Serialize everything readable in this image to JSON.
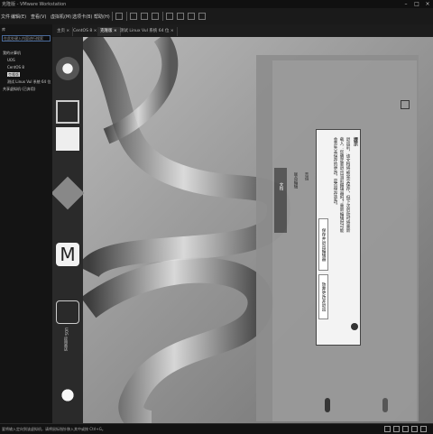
{
  "window": {
    "title": "克隆版 - VMware Workstation"
  },
  "menu": {
    "file": "文件",
    "edit": "编辑(E)",
    "view": "查看(V)",
    "vm": "虚拟机(M)",
    "tabs": "选项卡(B)",
    "help": "帮助(H)"
  },
  "library": {
    "header": "库",
    "search_placeholder": "在此处键入内容进行搜索",
    "items": [
      "我的计算机",
      "UOS",
      "CentOS 8",
      "克隆版",
      "测试 Linux Vul 系统 64 位",
      "共享虚拟机 (已弃用)"
    ]
  },
  "tabs": [
    "主页",
    "CentOS 8",
    "克隆版",
    "测试 Linux Vul 系统 64 位"
  ],
  "dialog": {
    "title": "提示",
    "body_lines": [
      "退出前，该文档将被完全保存，但下次启动时将重新",
      "载入：您确定要退出当前编辑器吗？重新编辑时可能",
      "会丢失未保存的更改，是否保存更改。"
    ],
    "save_btn": "保存并退出编辑器",
    "discard_btn": "放弃更改并退出"
  },
  "guest_labels": {
    "left_panel": "文档",
    "item1": "联合编辑",
    "item2": "音调",
    "item3": "文件"
  },
  "dock_labels": {
    "app5": "UOS 应用商店"
  },
  "status": {
    "message": "要将输入定向到该虚拟机，请将鼠标指针移入其中或按 Ctrl+G。"
  }
}
